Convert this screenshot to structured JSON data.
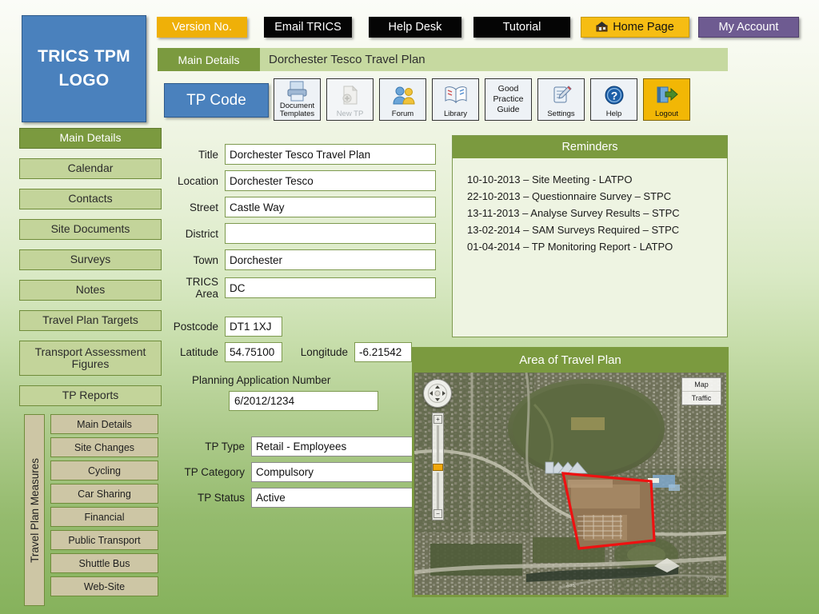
{
  "app": {
    "logo_line1": "TRICS TPM",
    "logo_line2": "LOGO",
    "accent_blue": "#4a81bd",
    "accent_green": "#7b9a3f",
    "accent_yellow": "#efb008",
    "accent_purple": "#6e5b91"
  },
  "topbar": {
    "version_label": "Version No.",
    "email_label": "Email TRICS",
    "helpdesk_label": "Help Desk",
    "tutorial_label": "Tutorial",
    "home_label": "Home Page",
    "home_icon": "home-page-icon",
    "account_label": "My Account"
  },
  "tabbar": {
    "tab_label": "Main Details",
    "title": "Dorchester Tesco Travel Plan"
  },
  "toolbar": {
    "tpcode_label": "TP Code",
    "tools": [
      {
        "label_line1": "Document",
        "label_line2": "Templates",
        "icon": "document-templates-icon",
        "disabled": false
      },
      {
        "label_line1": "New TP",
        "label_line2": "",
        "icon": "new-tp-icon",
        "disabled": true
      },
      {
        "label_line1": "Forum",
        "label_line2": "",
        "icon": "forum-icon",
        "disabled": false
      },
      {
        "label_line1": "Library",
        "label_line2": "",
        "icon": "library-icon",
        "disabled": false
      },
      {
        "label_line1": "Good",
        "label_line2": "Practice Guide",
        "icon": "good-practice-guide-icon",
        "disabled": false
      },
      {
        "label_line1": "Settings",
        "label_line2": "",
        "icon": "settings-icon",
        "disabled": false
      },
      {
        "label_line1": "Help",
        "label_line2": "",
        "icon": "help-icon",
        "disabled": false
      },
      {
        "label_line1": "Logout",
        "label_line2": "",
        "icon": "logout-icon",
        "disabled": false
      }
    ]
  },
  "sidebar": {
    "items": [
      {
        "label": "Main Details",
        "active": true
      },
      {
        "label": "Calendar",
        "active": false
      },
      {
        "label": "Contacts",
        "active": false
      },
      {
        "label": "Site Documents",
        "active": false
      },
      {
        "label": "Surveys",
        "active": false
      },
      {
        "label": "Notes",
        "active": false
      },
      {
        "label": "Travel Plan Targets",
        "active": false
      },
      {
        "label": "Transport Assessment Figures",
        "active": false
      },
      {
        "label": "TP Reports",
        "active": false
      }
    ]
  },
  "measures": {
    "group_label": "Travel Plan Measures",
    "items": [
      {
        "label": "Main Details"
      },
      {
        "label": "Site Changes"
      },
      {
        "label": "Cycling"
      },
      {
        "label": "Car Sharing"
      },
      {
        "label": "Financial"
      },
      {
        "label": "Public Transport"
      },
      {
        "label": "Shuttle Bus"
      },
      {
        "label": "Web-Site"
      }
    ]
  },
  "form": {
    "fields": [
      {
        "label": "Title",
        "value": "Dorchester Tesco Travel Plan"
      },
      {
        "label": "Location",
        "value": "Dorchester Tesco"
      },
      {
        "label": "Street",
        "value": "Castle Way"
      },
      {
        "label": "District",
        "value": ""
      },
      {
        "label": "Town",
        "value": "Dorchester"
      },
      {
        "label": "TRICS Area",
        "value": "DC"
      }
    ],
    "postcode_label": "Postcode",
    "postcode_value": "DT1 1XJ",
    "latitude_label": "Latitude",
    "latitude_value": "54.75100",
    "longitude_label": "Longitude",
    "longitude_value": "-6.21542",
    "planning_label": "Planning Application Number",
    "planning_value": "6/2012/1234",
    "selects": [
      {
        "label": "TP Type",
        "value": "Retail - Employees"
      },
      {
        "label": "TP Category",
        "value": "Compulsory"
      },
      {
        "label": "TP Status",
        "value": "Active"
      }
    ]
  },
  "reminders": {
    "header": "Reminders",
    "items": [
      "10-10-2013 – Site Meeting - LATPO",
      "22-10-2013 – Questionnaire Survey – STPC",
      "13-11-2013 – Analyse Survey Results – STPC",
      "13-02-2014 – SAM Surveys Required – STPC",
      "01-04-2014 – TP Monitoring Report - LATPO"
    ]
  },
  "map": {
    "header": "Area of Travel Plan",
    "maptype_label": "Map",
    "traffic_label": "Traffic",
    "pan_icon": "pan-control-icon",
    "zoom_in_label": "+",
    "zoom_out_label": "−",
    "site_outline_color": "#ee1111"
  }
}
